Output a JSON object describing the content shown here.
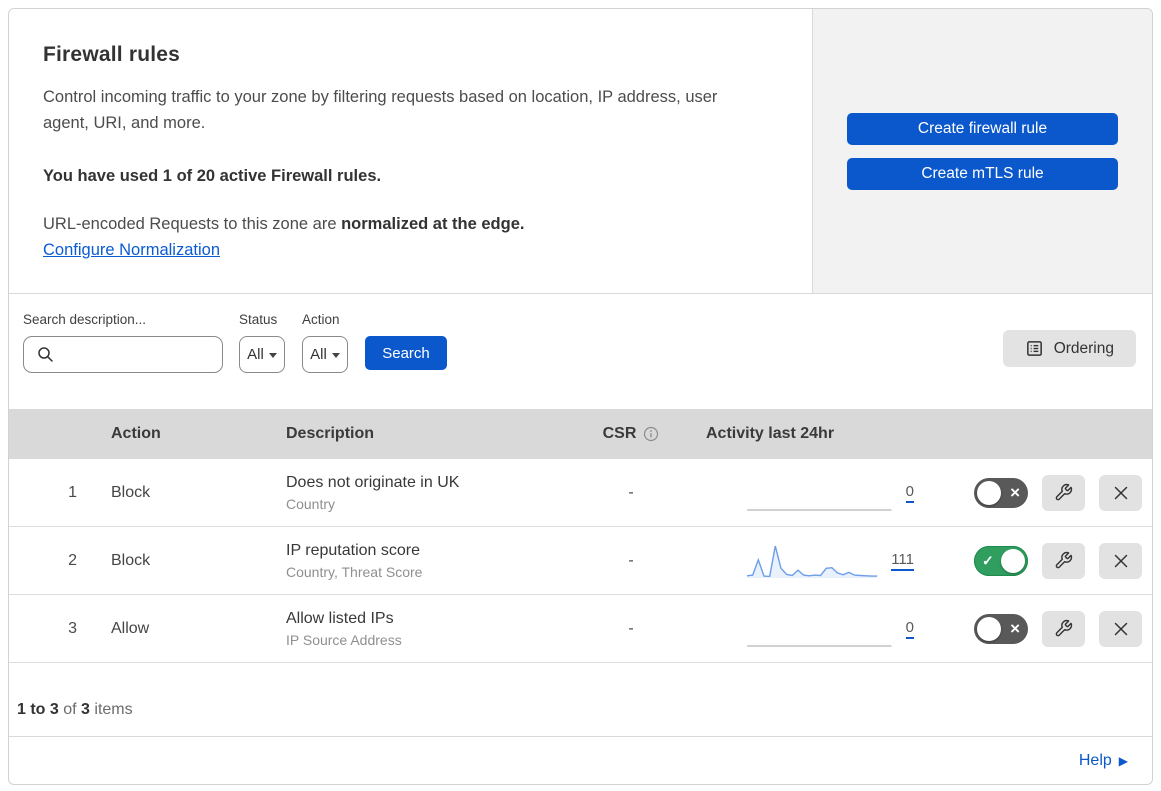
{
  "colors": {
    "accent_blue": "#0b58cd",
    "toggle_on_green": "#2f9e5f",
    "toggle_off_gray": "#595959",
    "sparkline_line": "#6d9eea",
    "sparkline_fill": "#e9f1fc",
    "flat_line_gray": "#c4c4c4",
    "panel_gray": "#f2f2f2",
    "table_header_gray": "#d9d9d9"
  },
  "header": {
    "title": "Firewall rules",
    "description": "Control incoming traffic to your zone by filtering requests based on location, IP address, user agent, URI, and more.",
    "usage_line": "You have used 1 of 20 active Firewall rules.",
    "normalization_prefix": "URL-encoded Requests to this zone are ",
    "normalization_bold": "normalized at the edge.",
    "normalization_link": "Configure Normalization"
  },
  "actions_panel": {
    "create_firewall_rule_label": "Create firewall rule",
    "create_mtls_rule_label": "Create mTLS rule"
  },
  "filters": {
    "search_label": "Search description...",
    "search_value": "",
    "status_label": "Status",
    "status_value": "All",
    "action_label": "Action",
    "action_value": "All",
    "search_button_label": "Search",
    "ordering_button_label": "Ordering"
  },
  "table": {
    "columns": {
      "action": "Action",
      "description": "Description",
      "csr": "CSR",
      "activity": "Activity last 24hr"
    },
    "rows": [
      {
        "priority": "1",
        "action": "Block",
        "description": "Does not originate in UK",
        "criteria": "Country",
        "csr": "-",
        "activity_count": "0",
        "activity_values": [
          0,
          0,
          0,
          0
        ],
        "enabled": false
      },
      {
        "priority": "2",
        "action": "Block",
        "description": "IP reputation score",
        "criteria": "Country, Threat Score",
        "csr": "-",
        "activity_count": "111",
        "activity_values": [
          4,
          6,
          55,
          3,
          2,
          100,
          28,
          8,
          5,
          22,
          6,
          4,
          6,
          5,
          28,
          30,
          13,
          7,
          15,
          6,
          5,
          4,
          3,
          3
        ],
        "enabled": true
      },
      {
        "priority": "3",
        "action": "Allow",
        "description": "Allow listed IPs",
        "criteria": "IP Source Address",
        "csr": "-",
        "activity_count": "0",
        "activity_values": [
          0,
          0,
          0,
          0
        ],
        "enabled": false
      }
    ]
  },
  "footer": {
    "range": "1 to 3",
    "of_text": "of",
    "total": "3",
    "items_text": "items",
    "help_label": "Help"
  }
}
